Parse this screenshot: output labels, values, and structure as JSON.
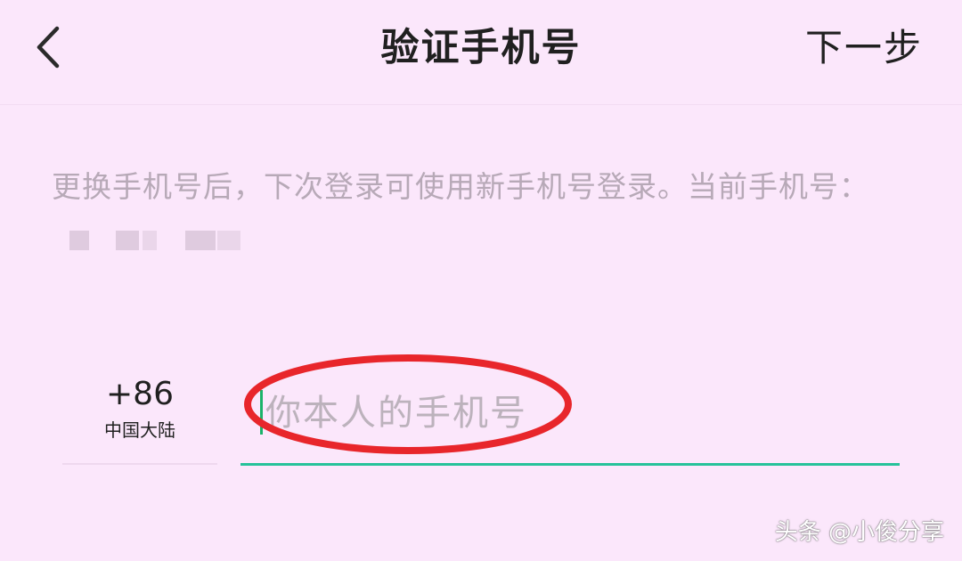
{
  "header": {
    "title": "验证手机号",
    "next_label": "下一步",
    "back_icon": "chevron-left-icon"
  },
  "description": {
    "text": "更换手机号后，下次登录可使用新手机号登录。当前手机号：",
    "masked_number": "blurred"
  },
  "country": {
    "code": "+86",
    "name": "中国大陆"
  },
  "phone_input": {
    "value": "",
    "placeholder": "你本人的手机号"
  },
  "annotation": {
    "shape": "ellipse",
    "color": "#e8262b"
  },
  "watermark": {
    "text": "头条 @小俊分享"
  },
  "colors": {
    "background": "#fbe7fb",
    "accent_underline": "#26c29a",
    "caret": "#1bb36a",
    "annotation_red": "#e8262b"
  }
}
